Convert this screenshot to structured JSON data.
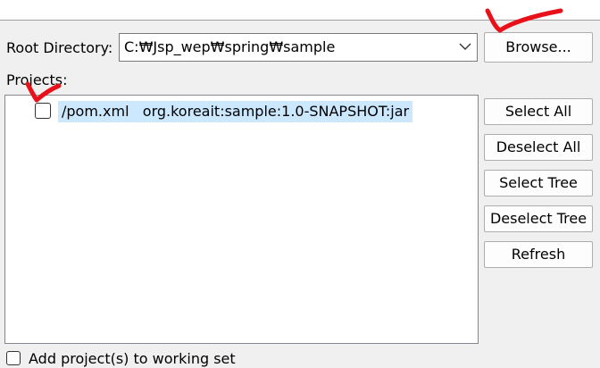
{
  "root_directory": {
    "label": "Root Directory:",
    "value": "C:₩Jsp_wep₩spring₩sample",
    "browse_label": "Browse..."
  },
  "projects": {
    "label": "Projects:",
    "items": [
      {
        "path": "/pom.xml",
        "artifact": "org.koreait:sample:1.0-SNAPSHOT:jar",
        "checked": false
      }
    ]
  },
  "actions": {
    "select_all": "Select All",
    "deselect_all": "Deselect All",
    "select_tree": "Select Tree",
    "deselect_tree": "Deselect Tree",
    "refresh": "Refresh"
  },
  "working_set": {
    "label": "Add project(s) to working set"
  },
  "colors": {
    "selection_highlight": "#cce8ff",
    "annotation_mark": "#e8111a"
  },
  "icons": {
    "combo_arrow": "chevron-down-icon",
    "annotation": "checkmark-annotation"
  }
}
